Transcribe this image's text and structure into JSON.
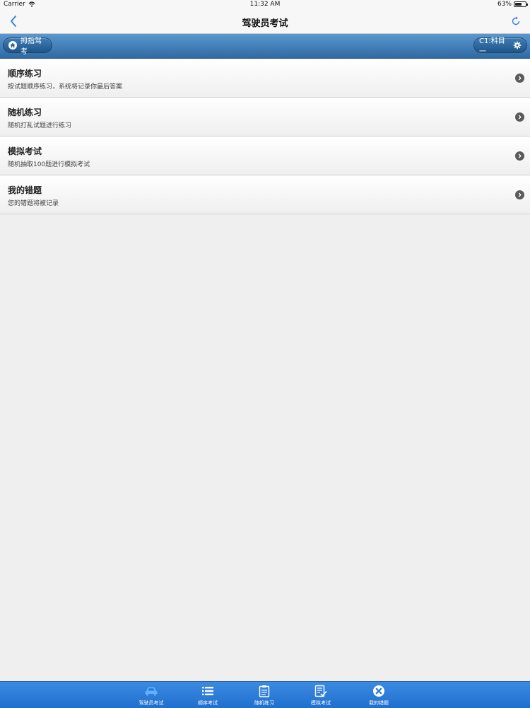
{
  "status_bar": {
    "carrier": "Carrier",
    "time": "11:32 AM",
    "battery": "63%",
    "battery_level": 0.63
  },
  "nav": {
    "title": "驾驶员考试",
    "back_icon": "chevron-left-icon",
    "refresh_icon": "refresh-icon"
  },
  "toolbar": {
    "left_label": "拇指驾考",
    "right_label": "C1:科目一"
  },
  "menu": [
    {
      "title": "顺序练习",
      "desc": "按试题顺序练习，系统将记录你最后答案"
    },
    {
      "title": "随机练习",
      "desc": "随机打乱试题进行练习"
    },
    {
      "title": "模拟考试",
      "desc": "随机抽取100题进行模拟考试"
    },
    {
      "title": "我的错题",
      "desc": "您的错题将被记录"
    }
  ],
  "tabs": [
    {
      "label": "驾驶员考试",
      "icon": "car-icon"
    },
    {
      "label": "顺序考试",
      "icon": "list-icon"
    },
    {
      "label": "随机练习",
      "icon": "clipboard-icon"
    },
    {
      "label": "模拟考试",
      "icon": "checklist-icon"
    },
    {
      "label": "我的错题",
      "icon": "close-circle-icon"
    }
  ],
  "colors": {
    "accent": "#2f7de0",
    "toolbar": "#3a74ad",
    "tabbar": "#2a7ad8"
  }
}
